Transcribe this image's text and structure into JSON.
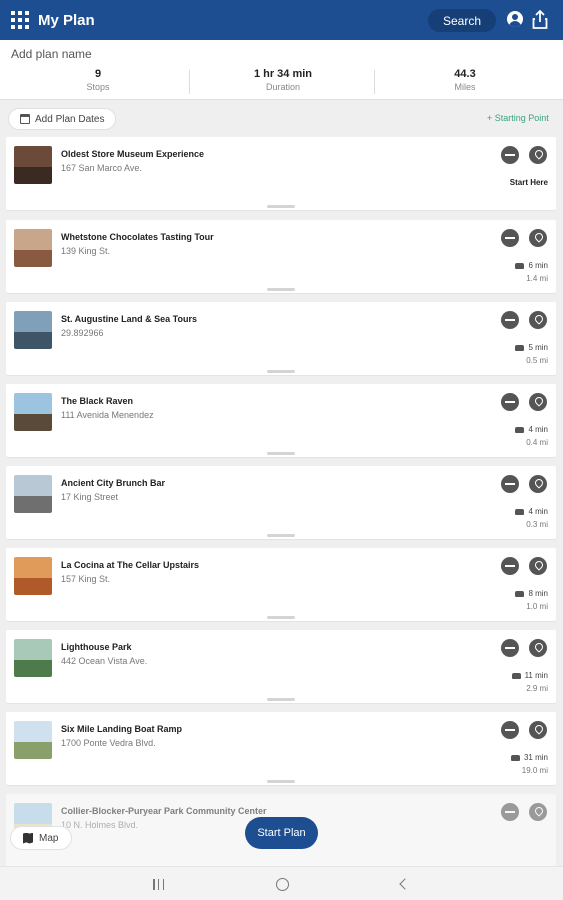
{
  "appbar": {
    "title": "My Plan",
    "search_label": "Search"
  },
  "summary": {
    "plan_name_placeholder": "Add plan name",
    "stops_value": "9",
    "stops_label": "Stops",
    "duration_value": "1 hr 34 min",
    "duration_label": "Duration",
    "miles_value": "44.3",
    "miles_label": "Miles"
  },
  "controls": {
    "add_dates_label": "Add Plan Dates",
    "starting_point_label": "+ Starting Point"
  },
  "stops": [
    {
      "name": "Oldest Store Museum Experience",
      "address": "167 San Marco Ave.",
      "time": "",
      "distance": "",
      "start_label": "Start Here"
    },
    {
      "name": "Whetstone Chocolates Tasting Tour",
      "address": "139 King St.",
      "time": "6 min",
      "distance": "1.4 mi",
      "start_label": ""
    },
    {
      "name": "St. Augustine Land & Sea Tours",
      "address": "29.892966",
      "time": "5 min",
      "distance": "0.5 mi",
      "start_label": ""
    },
    {
      "name": "The Black Raven",
      "address": "111 Avenida Menendez",
      "time": "4 min",
      "distance": "0.4 mi",
      "start_label": ""
    },
    {
      "name": "Ancient City Brunch Bar",
      "address": "17 King Street",
      "time": "4 min",
      "distance": "0.3 mi",
      "start_label": ""
    },
    {
      "name": "La Cocina at The Cellar Upstairs",
      "address": "157 King St.",
      "time": "8 min",
      "distance": "1.0 mi",
      "start_label": ""
    },
    {
      "name": "Lighthouse Park",
      "address": "442 Ocean Vista Ave.",
      "time": "11 min",
      "distance": "2.9 mi",
      "start_label": ""
    },
    {
      "name": "Six Mile Landing Boat Ramp",
      "address": "1700 Ponte Vedra Blvd.",
      "time": "31 min",
      "distance": "19.0 mi",
      "start_label": ""
    },
    {
      "name": "Collier-Blocker-Puryear Park Community Center",
      "address": "10 N. Holmes Blvd.",
      "time": "",
      "distance": "",
      "start_label": ""
    }
  ],
  "bottom": {
    "map_label": "Map",
    "start_plan_label": "Start Plan"
  },
  "colors": {
    "brand": "#1c4e91",
    "accent": "#3aa37d"
  }
}
